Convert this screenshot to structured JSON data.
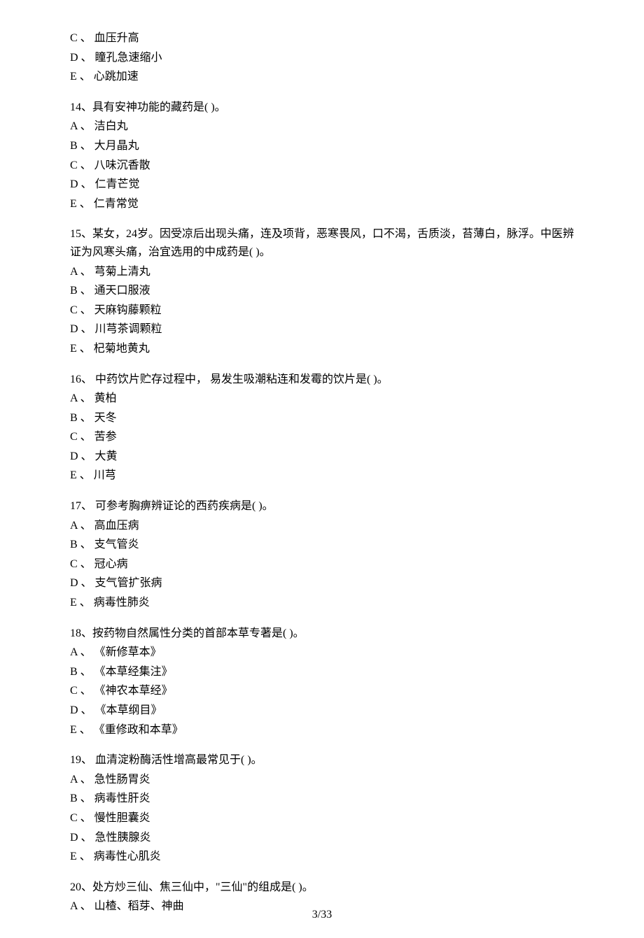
{
  "partial_options_top": [
    "C 、 血压升高",
    "D 、 瞳孔急速缩小",
    "E 、 心跳加速"
  ],
  "questions": [
    {
      "text": "14、具有安神功能的藏药是(    )。",
      "options": [
        "A 、 洁白丸",
        "B 、 大月晶丸",
        "C 、 八味沉香散",
        "D 、 仁青芒觉",
        "E 、 仁青常觉"
      ]
    },
    {
      "text": "15、某女，24岁。因受凉后出现头痛，连及项背，恶寒畏风，口不渴，舌质淡，苔薄白，脉浮。中医辨证为风寒头痛，治宜选用的中成药是(    )。",
      "options": [
        "A 、 芎菊上清丸",
        "B 、 通天口服液",
        "C 、 天麻钩藤颗粒",
        "D 、 川芎茶调颗粒",
        "E 、 杞菊地黄丸"
      ]
    },
    {
      "text": "16、 中药饮片贮存过程中， 易发生吸潮粘连和发霉的饮片是(    )。",
      "options": [
        "A 、 黄柏",
        "B 、 天冬",
        "C 、 苦参",
        "D 、 大黄",
        "E 、 川芎"
      ]
    },
    {
      "text": "17、 可参考胸痹辨证论的西药疾病是(    )。",
      "options": [
        "A 、 高血压病",
        "B 、 支气管炎",
        "C 、 冠心病",
        "D 、 支气管扩张病",
        "E 、 病毒性肺炎"
      ]
    },
    {
      "text": "18、按药物自然属性分类的首部本草专著是(    )。",
      "options": [
        "A 、 《新修草本》",
        "B 、 《本草经集注》",
        "C 、 《神农本草经》",
        "D 、 《本草纲目》",
        "E 、 《重修政和本草》"
      ]
    },
    {
      "text": "19、 血清淀粉酶活性增高最常见于(    )。",
      "options": [
        "A 、 急性肠胃炎",
        "B 、 病毒性肝炎",
        "C 、 慢性胆囊炎",
        "D 、 急性胰腺炎",
        "E 、 病毒性心肌炎"
      ]
    },
    {
      "text": "20、处方炒三仙、焦三仙中，\"三仙\"的组成是(     )。",
      "options": [
        "A 、 山楂、稻芽、神曲"
      ]
    }
  ],
  "page_number": "3/33"
}
